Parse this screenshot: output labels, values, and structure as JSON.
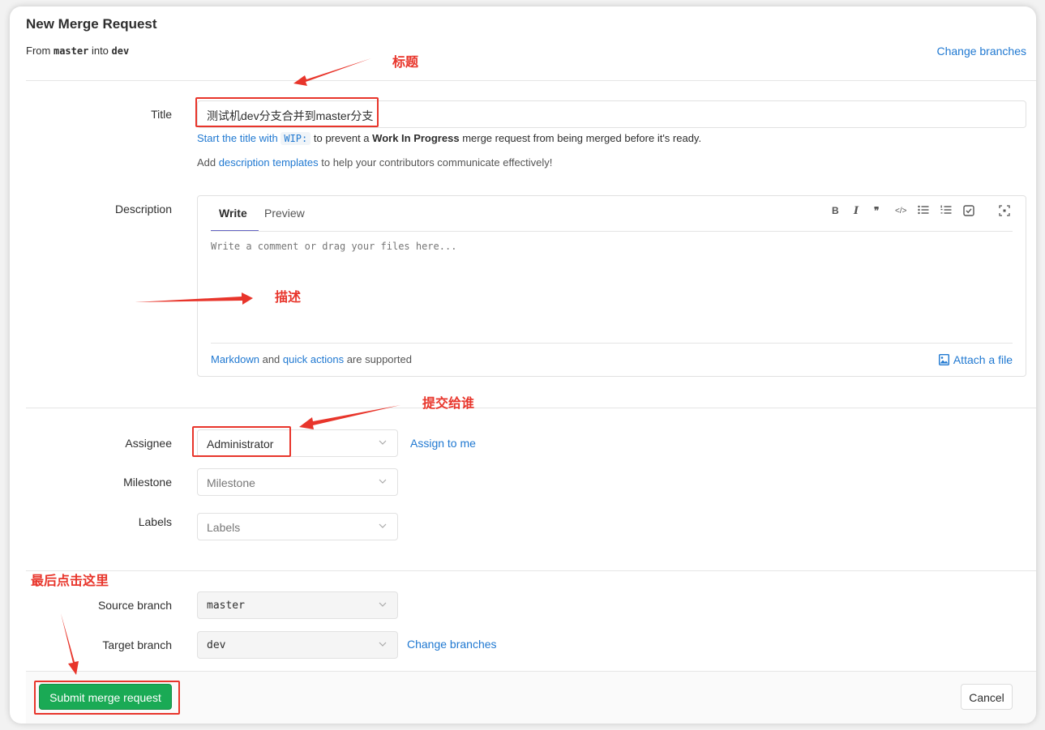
{
  "header": {
    "title": "New Merge Request",
    "from_prefix": "From",
    "source": "master",
    "into": "into",
    "target": "dev",
    "change_branches": "Change branches"
  },
  "form": {
    "title_label": "Title",
    "title_value": "测试机dev分支合并到master分支",
    "wip_hint": {
      "pre": "Start the title with",
      "code": "WIP:",
      "mid": "to prevent a",
      "bold": "Work In Progress",
      "post": "merge request from being merged before it's ready."
    },
    "template_hint": {
      "pre": "Add",
      "link": "description templates",
      "post": "to help your contributors communicate effectively!"
    },
    "description_label": "Description",
    "tabs": {
      "write": "Write",
      "preview": "Preview"
    },
    "toolbar": [
      "B",
      "I",
      "99",
      "code",
      "ul",
      "ol",
      "task",
      "fullscreen"
    ],
    "description_placeholder": "Write a comment or drag your files here...",
    "footer": {
      "markdown": "Markdown",
      "and": "and",
      "quick_actions": "quick actions",
      "supported": "are supported",
      "attach": "Attach a file"
    },
    "assignee_label": "Assignee",
    "assignee_value": "Administrator",
    "assign_to_me": "Assign to me",
    "milestone_label": "Milestone",
    "milestone_value": "Milestone",
    "labels_label": "Labels",
    "labels_value": "Labels",
    "source_branch_label": "Source branch",
    "source_branch_value": "master",
    "target_branch_label": "Target branch",
    "target_branch_value": "dev",
    "change_branches": "Change branches"
  },
  "actions": {
    "submit": "Submit merge request",
    "cancel": "Cancel"
  },
  "annotations": {
    "title": "标题",
    "description": "描述",
    "assignee": "提交给谁",
    "submit": "最后点击这里",
    "color": "#e8352b"
  }
}
